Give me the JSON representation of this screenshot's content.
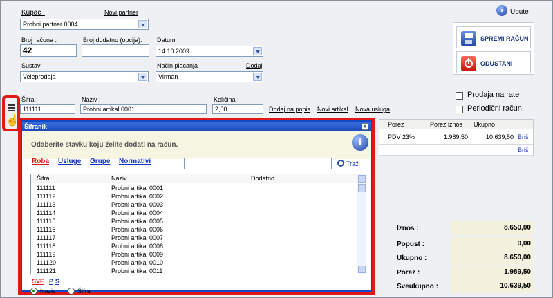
{
  "form": {
    "kupac_label": "Kupac :",
    "novi_partner": "Novi partner",
    "kupac_value": "Probni partner 0004",
    "broj_racuna_label": "Broj računa :",
    "broj_racuna_value": "42",
    "broj_dodatno_label": "Broj dodatno (opcija):",
    "datum_label": "Datum",
    "datum_value": "14.10.2009",
    "sustav_label": "Sustav",
    "sustav_value": "Veleprodaja",
    "nacin_placanja_label": "Način plaćanja",
    "dodaj": "Dodaj",
    "nacin_placanja_value": "Virman",
    "sifra_label": "Šifra :",
    "sifra_value": "111111",
    "naziv_label": "Naziv :",
    "naziv_value": "Probni artikal 0001",
    "kolicina_label": "Količina :",
    "kolicina_value": "2,00",
    "dodaj_na_popis": "Dodaj na popis",
    "novi_artikal": "Novi artikal",
    "nova_usluga": "Nova usluga"
  },
  "header": {
    "upute": "Upute",
    "spremi": "SPREMI RAČUN",
    "odustani": "ODUSTANI",
    "prodaja_na_rate": "Prodaja na rate",
    "periodicni_racun": "Periodični račun"
  },
  "grid": {
    "columns": [
      "Porez",
      "Porez iznos",
      "Ukupno"
    ],
    "row1": {
      "porez": "PDV 23%",
      "porez_iznos": "1.989,50",
      "ukupno": "10.639,50",
      "brisi": "Briši"
    },
    "row2": {
      "brisi": "Briši"
    }
  },
  "totals": [
    {
      "label": "Iznos :",
      "value": "8.650,00"
    },
    {
      "label": "Popust :",
      "value": "0,00"
    },
    {
      "label": "Ukupno :",
      "value": "8.650,00"
    },
    {
      "label": "Porez :",
      "value": "1.989,50"
    },
    {
      "label": "Sveukupno :",
      "value": "10.639,50"
    }
  ],
  "dialog": {
    "title": "Šifranik",
    "close": "x",
    "banner_text": "Odaberite stavku koju želite dodati na račun.",
    "tabs": [
      "Roba",
      "Usluge",
      "Grupe",
      "Normativi"
    ],
    "search_value": "",
    "search_button": "Traži",
    "columns": [
      "Šifra",
      "Naziv",
      "Dodatno"
    ],
    "rows": [
      {
        "sifra": "111111",
        "naziv": "Probni artikal 0001"
      },
      {
        "sifra": "111112",
        "naziv": "Probni artikal 0002"
      },
      {
        "sifra": "111113",
        "naziv": "Probni artikal 0003"
      },
      {
        "sifra": "111114",
        "naziv": "Probni artikal 0004"
      },
      {
        "sifra": "111115",
        "naziv": "Probni artikal 0005"
      },
      {
        "sifra": "111116",
        "naziv": "Probni artikal 0006"
      },
      {
        "sifra": "111117",
        "naziv": "Probni artikal 0007"
      },
      {
        "sifra": "111118",
        "naziv": "Probni artikal 0008"
      },
      {
        "sifra": "111119",
        "naziv": "Probni artikal 0009"
      },
      {
        "sifra": "111120",
        "naziv": "Probni artikal 0010"
      },
      {
        "sifra": "111121",
        "naziv": "Probni artikal 0011"
      }
    ],
    "filter_sve": "SVE",
    "filter_p": "P",
    "filter_s": "S",
    "radio_naziv": "Naziv",
    "radio_sifra": "Šifra"
  },
  "colors": {
    "accent": "#1533c8",
    "highlight": "#e11818",
    "dialog_border": "#1148c6"
  }
}
